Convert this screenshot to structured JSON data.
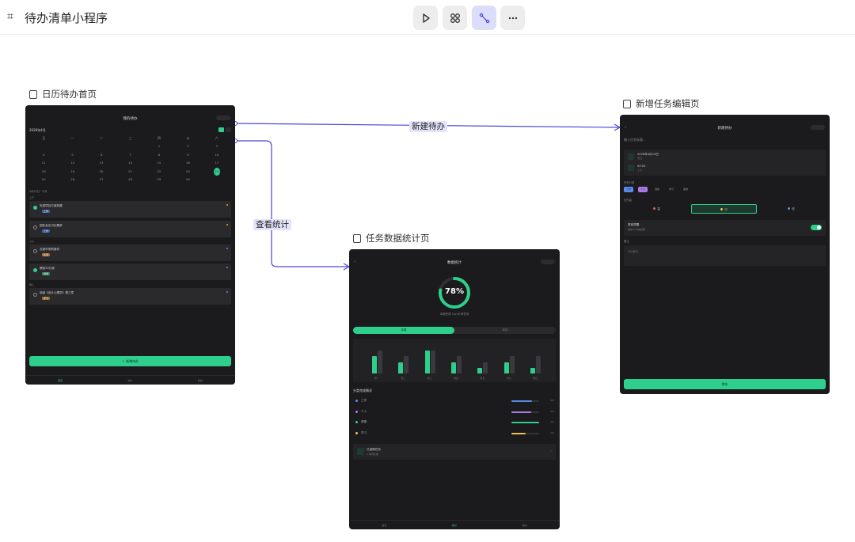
{
  "app": {
    "title": "待办清单小程序"
  },
  "toolbar": {
    "buttons": [
      "play-icon",
      "components-icon",
      "flow-icon",
      "more-icon"
    ]
  },
  "frames": {
    "home": {
      "label": "日历待办首页",
      "header_title": "我的待办",
      "month": "2026年4月",
      "weekdays": [
        "日",
        "一",
        "二",
        "三",
        "四",
        "五",
        "六"
      ],
      "dates": [
        "",
        "",
        "",
        "",
        "1",
        "2",
        "3",
        "4",
        "5",
        "6",
        "7",
        "8",
        "9",
        "10",
        "11",
        "12",
        "13",
        "14",
        "15",
        "16",
        "17",
        "18",
        "19",
        "20",
        "21",
        "22",
        "23",
        "24",
        "25",
        "26",
        "27",
        "28",
        "29",
        "30",
        ""
      ],
      "today": "24",
      "summary": "4月24日 · 今天",
      "groups": [
        "上午",
        "下午",
        "晚上"
      ],
      "tasks": [
        {
          "name": "完成项目方案初稿",
          "done": true,
          "tag": "工作"
        },
        {
          "name": "团队会议讨论需求",
          "done": false,
          "tag": "工作"
        },
        {
          "name": "去超市采购食材",
          "done": false,
          "tag": "生活"
        },
        {
          "name": "健身30分钟",
          "done": true,
          "tag": "健康"
        },
        {
          "name": "阅读《设计心理学》第三章",
          "done": false,
          "tag": "学习"
        }
      ],
      "add_button": "＋ 新增待办",
      "tabs": [
        "首页",
        "统计",
        "我的"
      ]
    },
    "stats": {
      "label": "任务数据统计页",
      "header_title": "数据统计",
      "percent": "78%",
      "caption": "本周完成 14/18 项任务",
      "segments": [
        "本周",
        "本月"
      ],
      "chart_days": [
        "周一",
        "周二",
        "周三",
        "周四",
        "周五",
        "周六",
        "周日"
      ],
      "section_title": "分类完成情况",
      "categories": [
        {
          "name": "工作",
          "count": "6/8",
          "color": "#5b8def",
          "ratio": 0.75
        },
        {
          "name": "个人",
          "count": "3/4",
          "color": "#a77be8",
          "ratio": 0.7
        },
        {
          "name": "健康",
          "count": "4/4",
          "color": "#2ecf8d",
          "ratio": 1.0
        },
        {
          "name": "学习",
          "count": "1/2",
          "color": "#f0c24b",
          "ratio": 0.5
        }
      ],
      "pending_title": "已逾期任务",
      "pending_sub": "2 项待处理",
      "tabs": [
        "首页",
        "统计",
        "我的"
      ]
    },
    "edit": {
      "label": "新增任务编辑页",
      "header_title": "新建待办",
      "input_placeholder": "输入任务标题…",
      "date_value": "2026年4月24日",
      "date_sub": "周五",
      "time_value": "09:00",
      "time_sub": "上午",
      "category_label": "任务分类",
      "categories": [
        "工作",
        "个人",
        "健康",
        "学习",
        "其他"
      ],
      "priority_label": "优先级",
      "priorities": [
        "高",
        "中",
        "低"
      ],
      "reminder_title": "提前提醒",
      "reminder_sub": "提前15分钟提醒",
      "notes_label": "备注",
      "notes_placeholder": "添加备注…",
      "save": "保存"
    }
  },
  "connectors": {
    "new_todo": "新建待办",
    "view_stats": "查看统计"
  }
}
